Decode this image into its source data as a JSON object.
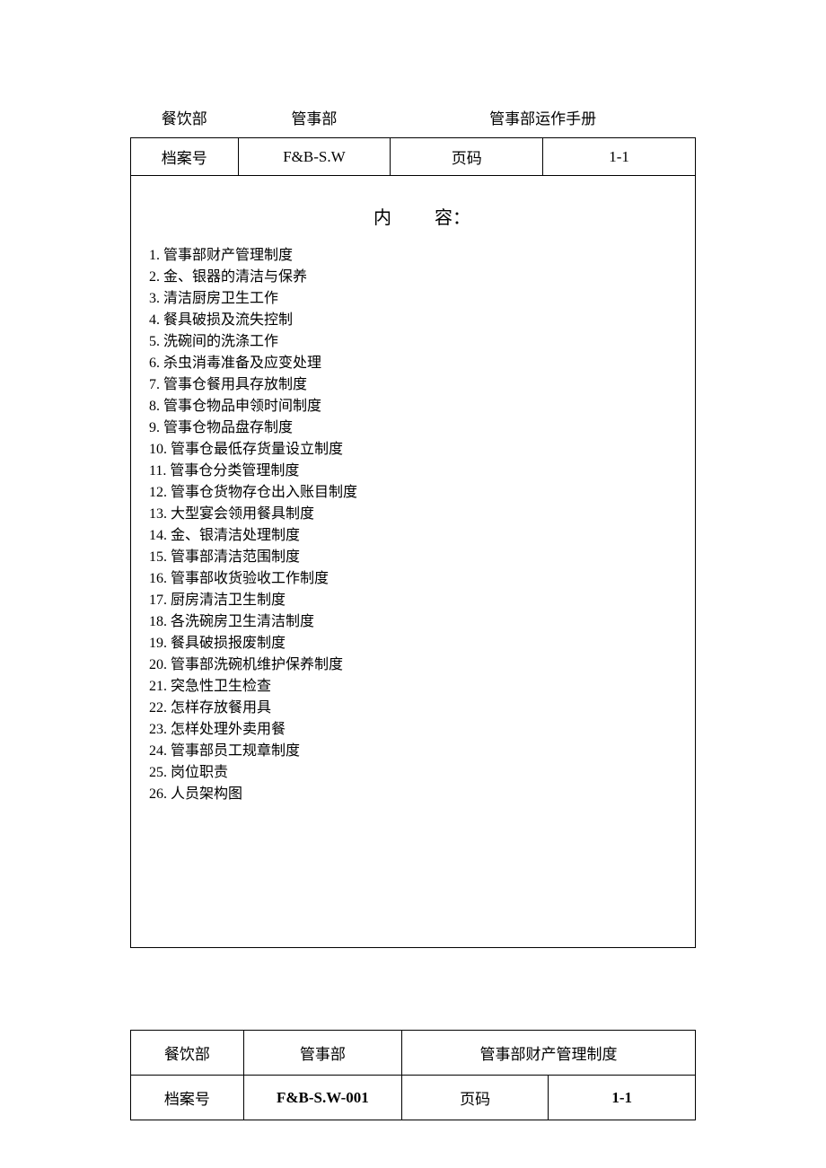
{
  "header1": {
    "row1": {
      "col1": "餐饮部",
      "col2": "管事部",
      "col3": "管事部运作手册"
    },
    "row2": {
      "col1": "档案号",
      "col2": "F&B-S.W",
      "col3": "页码",
      "col4": "1-1"
    }
  },
  "content_title_left": "内",
  "content_title_right": "容：",
  "toc": [
    "1. 管事部财产管理制度",
    "2. 金、银器的清洁与保养",
    "3. 清洁厨房卫生工作",
    "4. 餐具破损及流失控制",
    "5. 洗碗间的洗涤工作",
    "6. 杀虫消毒准备及应变处理",
    "7. 管事仓餐用具存放制度",
    "8. 管事仓物品申领时间制度",
    "9. 管事仓物品盘存制度",
    "10. 管事仓最低存货量设立制度",
    "11. 管事仓分类管理制度",
    "12. 管事仓货物存仓出入账目制度",
    "13. 大型宴会领用餐具制度",
    "14. 金、银清洁处理制度",
    "15. 管事部清洁范围制度",
    "16. 管事部收货验收工作制度",
    "17. 厨房清洁卫生制度",
    "18. 各洗碗房卫生清洁制度",
    "19. 餐具破损报废制度",
    "20. 管事部洗碗机维护保养制度",
    "21. 突急性卫生检查",
    "22. 怎样存放餐用具",
    "23. 怎样处理外卖用餐",
    "24. 管事部员工规章制度",
    "25. 岗位职责",
    "26. 人员架构图"
  ],
  "header2": {
    "row1": {
      "col1": "餐饮部",
      "col2": "管事部",
      "col3": "管事部财产管理制度"
    },
    "row2": {
      "col1": "档案号",
      "col2": "F&B-S.W-001",
      "col3": "页码",
      "col4": "1-1"
    }
  }
}
